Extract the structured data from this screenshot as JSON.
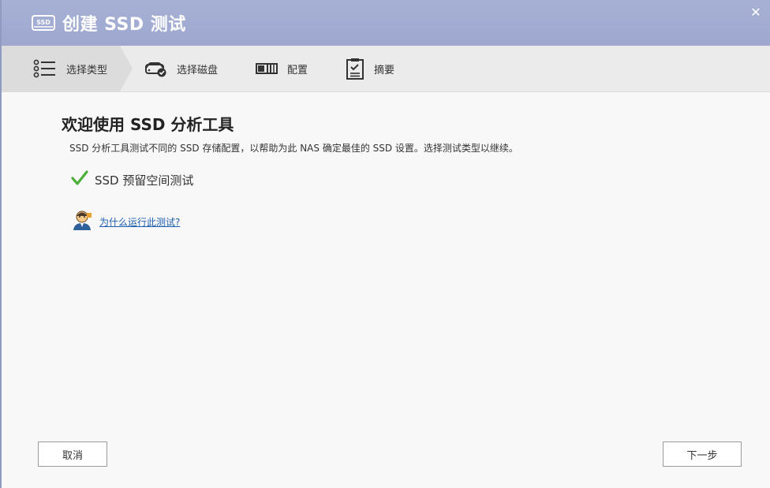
{
  "window": {
    "title": "创建 SSD 测试",
    "title_icon": "ssd-icon",
    "close_symbol": "✕"
  },
  "steps": [
    {
      "label": "选择类型",
      "icon": "list-icon",
      "active": true
    },
    {
      "label": "选择磁盘",
      "icon": "disk-check-icon",
      "active": false
    },
    {
      "label": "配置",
      "icon": "config-icon",
      "active": false
    },
    {
      "label": "摘要",
      "icon": "clipboard-icon",
      "active": false
    }
  ],
  "content": {
    "heading": "欢迎使用 SSD 分析工具",
    "description": "SSD 分析工具测试不同的 SSD 存储配置，以帮助为此 NAS 确定最佳的 SSD 设置。选择测试类型以继续。",
    "option_label": "SSD 预留空间测试",
    "option_selected": true,
    "help_link": "为什么运行此测试?"
  },
  "buttons": {
    "cancel": "取消",
    "next": "下一步"
  },
  "colors": {
    "titlebar": "#a3acd2",
    "check": "#4caf3a",
    "link": "#1f5fb0"
  }
}
